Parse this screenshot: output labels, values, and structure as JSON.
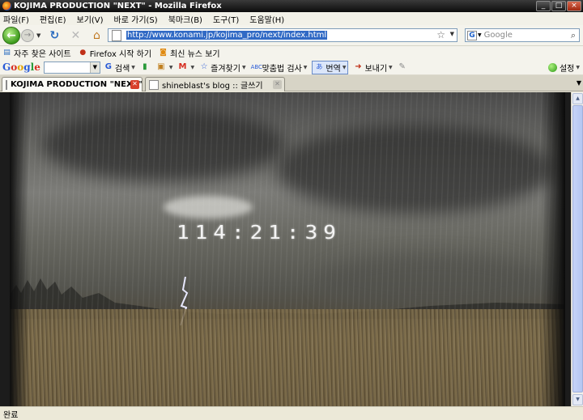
{
  "window": {
    "title": "KOJIMA PRODUCTION \"NEXT\" - Mozilla Firefox",
    "buttons": [
      "_",
      "□",
      "×"
    ]
  },
  "menu": [
    "파일(F)",
    "편집(E)",
    "보기(V)",
    "바로 가기(S)",
    "북마크(B)",
    "도구(T)",
    "도움말(H)"
  ],
  "nav": {
    "back_icon": "←",
    "forward_icon": "→",
    "url": "http://www.konami.jp/kojima_pro/next/index.html",
    "search_placeholder": "Google"
  },
  "bookmarks": [
    {
      "icon": "bookmark-star-icon",
      "label": "자주 찾은 사이트"
    },
    {
      "icon": "firefox-icon",
      "label": "Firefox 시작 하기"
    },
    {
      "icon": "rss-icon",
      "label": "최신 뉴스 보기"
    }
  ],
  "google_toolbar": {
    "logo": [
      "G",
      "o",
      "o",
      "g",
      "l",
      "e"
    ],
    "search_label": "검색",
    "bookmarks_label": "즐겨찾기",
    "spellcheck_label": "맞춤법 검사",
    "translate_label": "번역",
    "send_label": "보내기",
    "settings_label": "설정"
  },
  "tabs": [
    {
      "title": "KOJIMA PRODUCTION \"NEXT\"",
      "active": true
    },
    {
      "title": "shineblast's blog :: 글쓰기",
      "active": false
    }
  ],
  "page": {
    "countdown": "114:21:39"
  },
  "status": {
    "text": "완료"
  }
}
